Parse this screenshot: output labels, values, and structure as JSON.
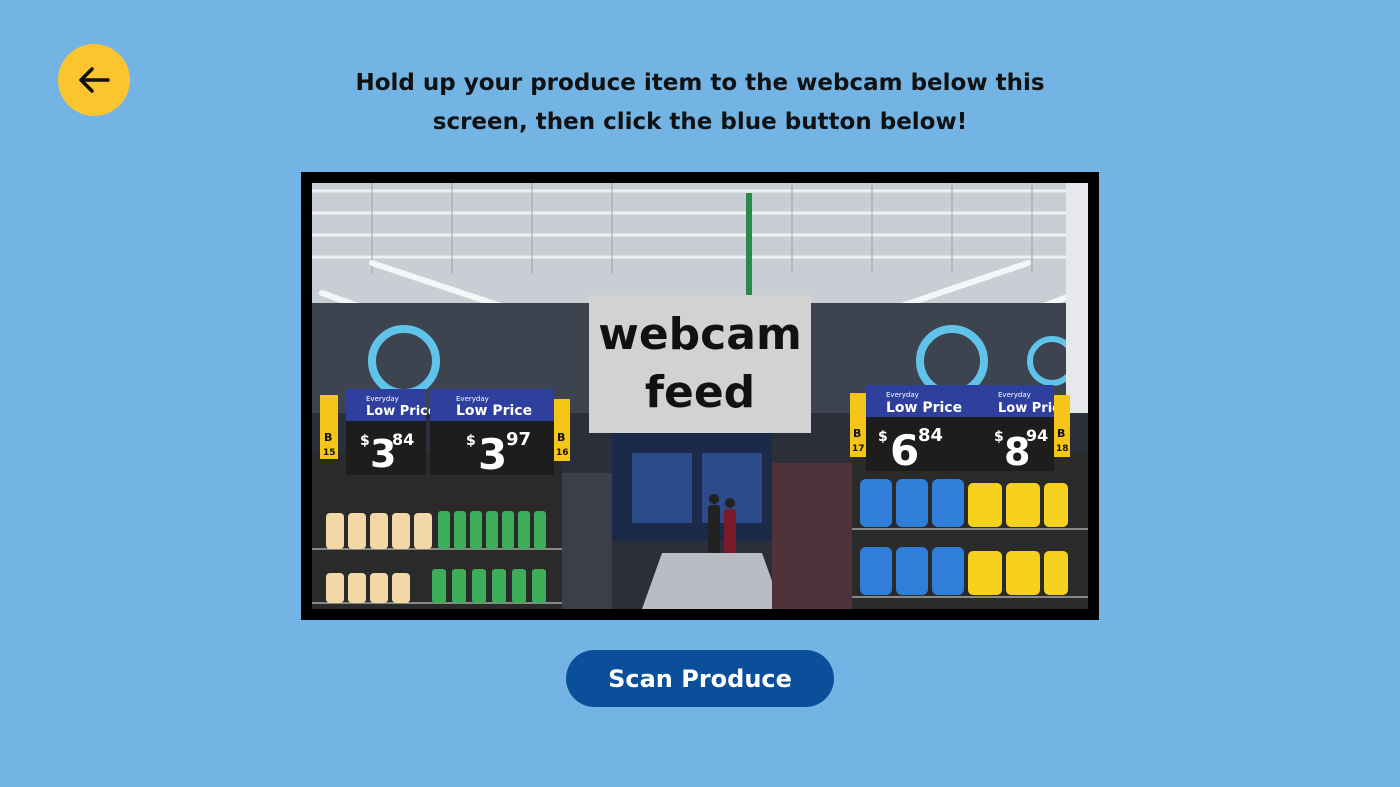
{
  "nav": {
    "back_icon": "arrow-left-icon"
  },
  "instructions": {
    "line1": "Hold up your produce item to the webcam below this",
    "line2": "screen, then click the blue button below!"
  },
  "webcam": {
    "label_line1": "webcam",
    "label_line2": "feed",
    "signs": [
      {
        "tag": "Everyday",
        "title": "Low Price",
        "price": "3",
        "cents": "84",
        "aisle": "B",
        "aisle_num": "15"
      },
      {
        "tag": "Everyday",
        "title": "Low Price",
        "price": "3",
        "cents": "97",
        "aisle": "B",
        "aisle_num": "16"
      },
      {
        "tag": "Everyday",
        "title": "Low Price",
        "price": "6",
        "cents": "84",
        "aisle": "B",
        "aisle_num": "17"
      },
      {
        "tag": "Everyday",
        "title": "Low Price",
        "price": "8",
        "cents": "94",
        "aisle": "B",
        "aisle_num": "18"
      }
    ]
  },
  "actions": {
    "scan_label": "Scan Produce"
  },
  "colors": {
    "background": "#73b4e4",
    "back_button": "#fbc530",
    "scan_button": "#0b4f9a"
  }
}
